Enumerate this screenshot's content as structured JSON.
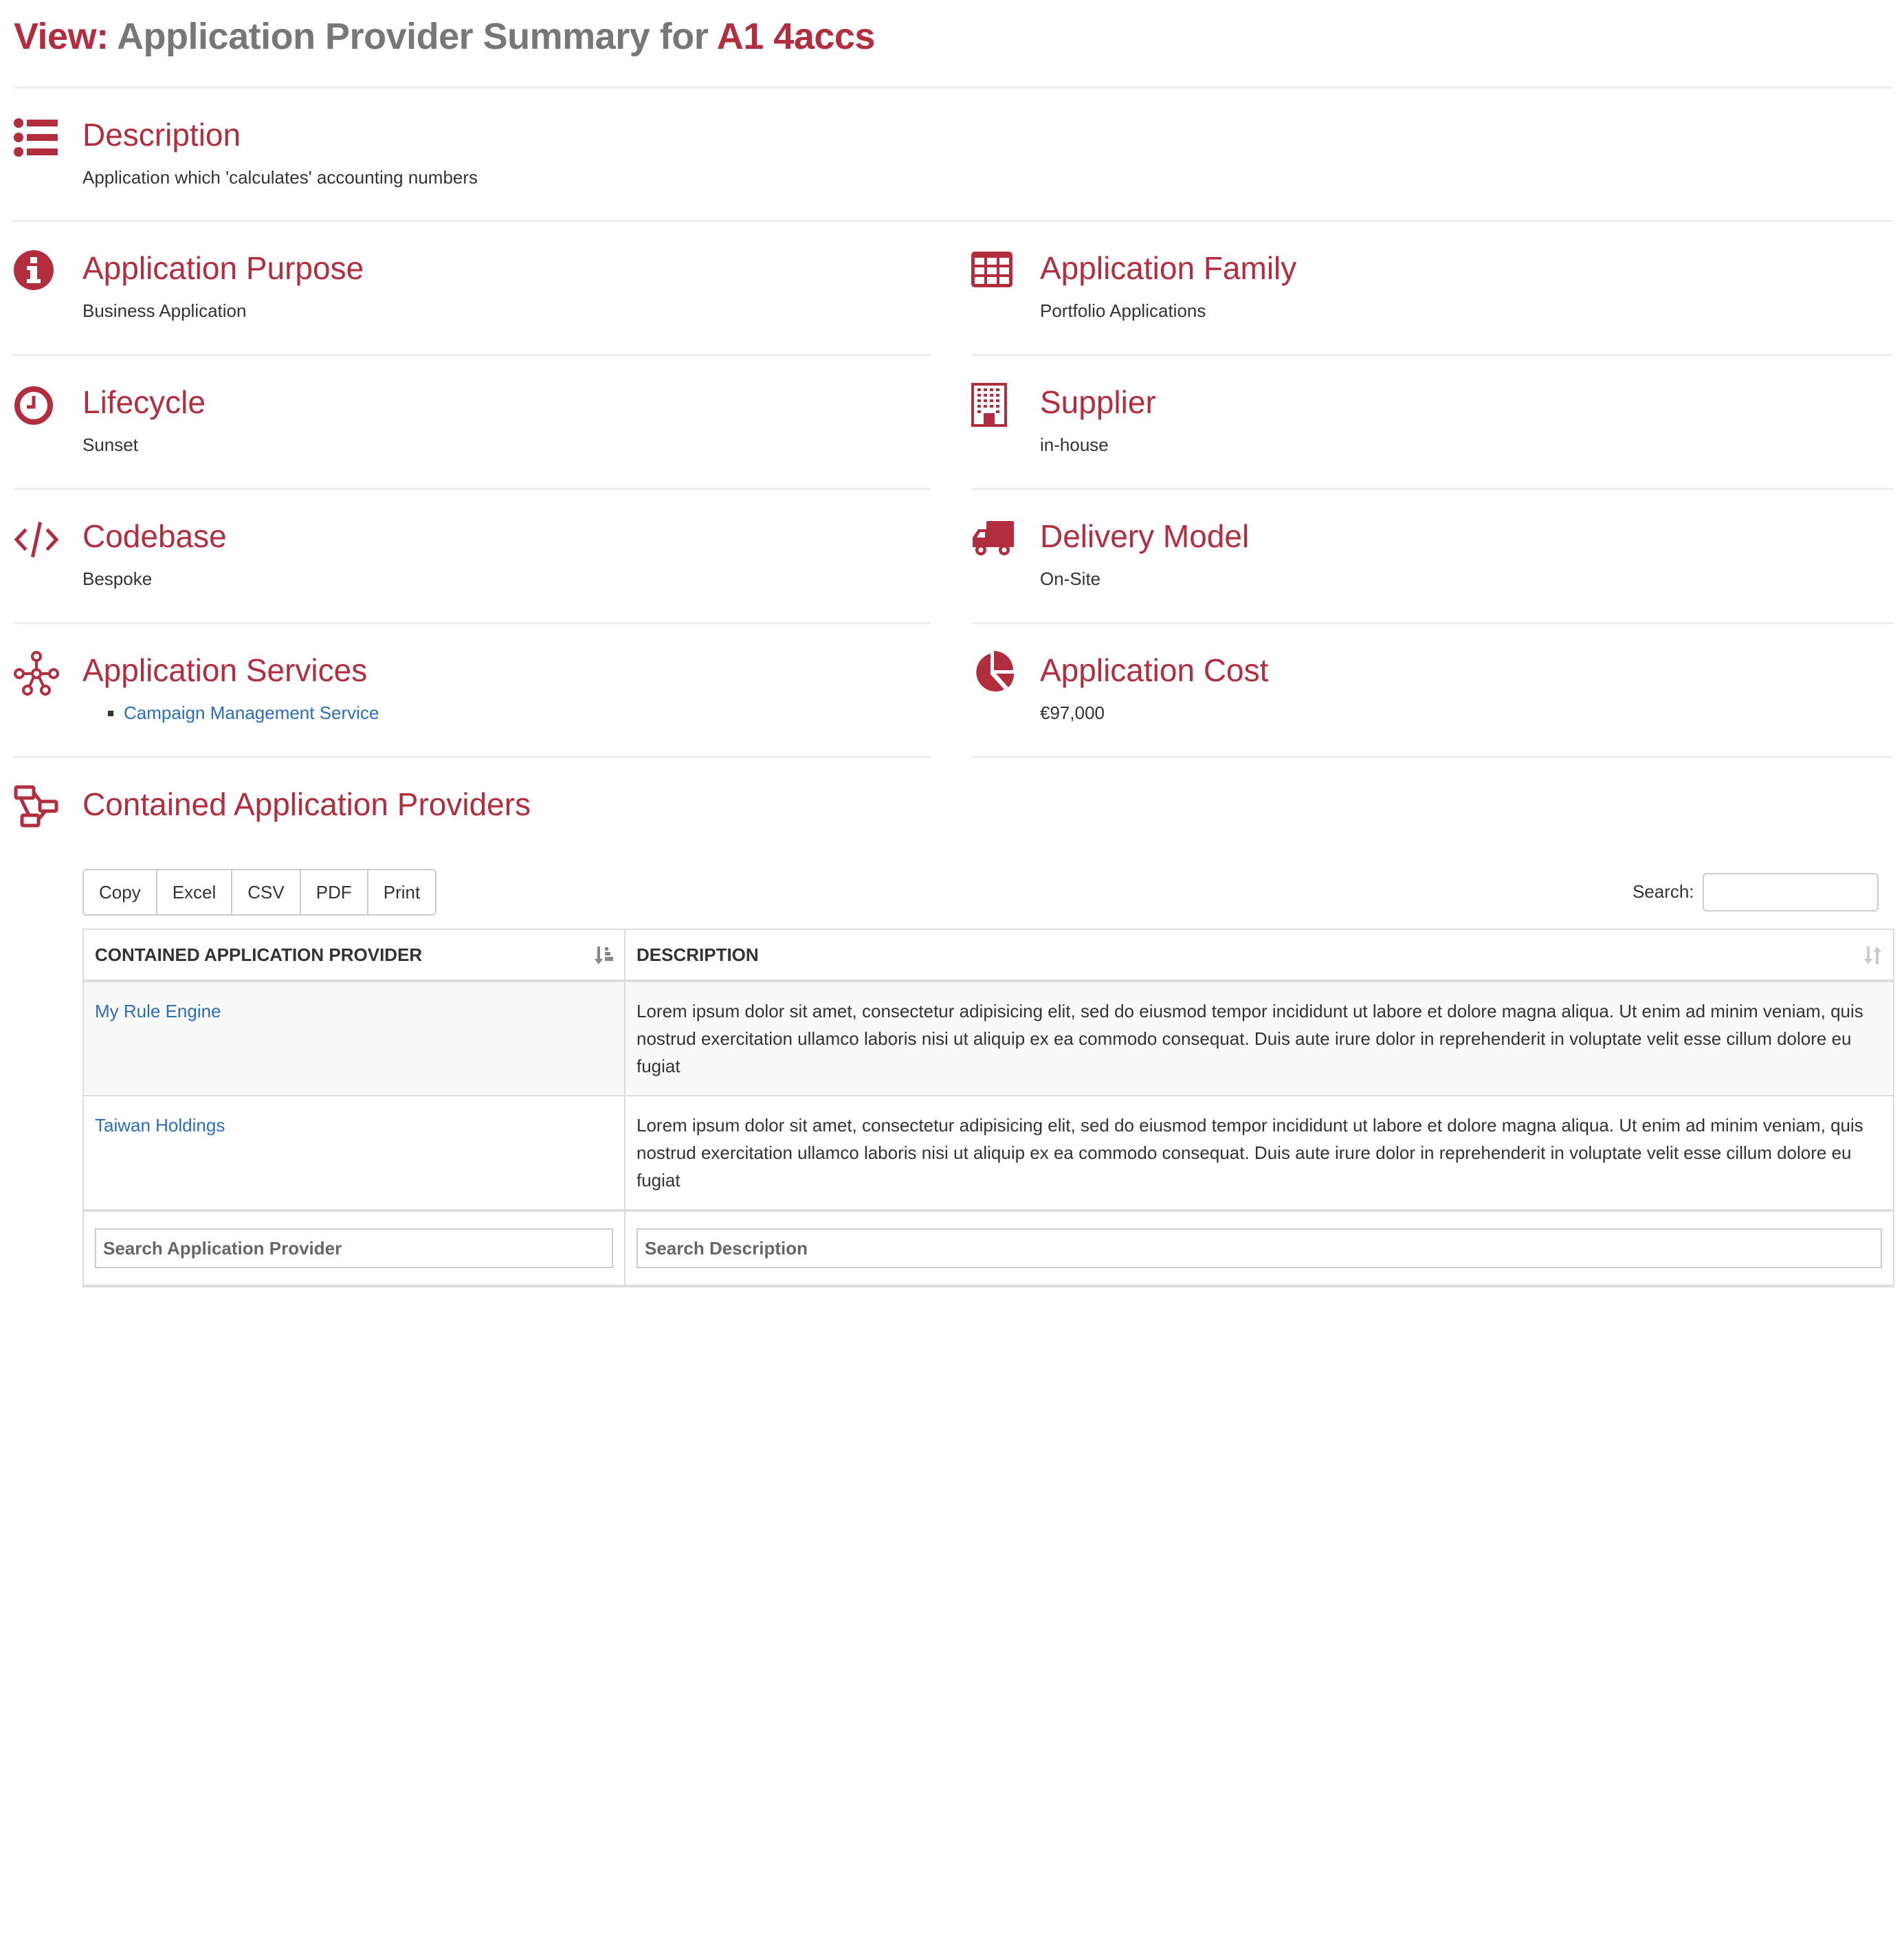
{
  "header": {
    "prefix": "View:",
    "title": " Application Provider Summary for ",
    "subject": "A1 4accs"
  },
  "colors": {
    "accent": "#b22e3e",
    "title_gray": "#777777",
    "link": "#2a6ebb",
    "text": "#333333"
  },
  "sections": {
    "description": {
      "icon": "list-icon",
      "title": "Description",
      "value": "Application which 'calculates' accounting numbers"
    },
    "purpose": {
      "icon": "info-circle-icon",
      "title": "Application Purpose",
      "value": "Business Application"
    },
    "family": {
      "icon": "table-grid-icon",
      "title": "Application Family",
      "value": "Portfolio Applications"
    },
    "lifecycle": {
      "icon": "clock-icon",
      "title": "Lifecycle",
      "value": "Sunset"
    },
    "supplier": {
      "icon": "building-icon",
      "title": "Supplier",
      "value": "in-house"
    },
    "codebase": {
      "icon": "code-icon",
      "title": "Codebase",
      "value": "Bespoke"
    },
    "delivery": {
      "icon": "truck-icon",
      "title": "Delivery Model",
      "value": "On-Site"
    },
    "services": {
      "icon": "network-nodes-icon",
      "title": "Application Services",
      "items": [
        "Campaign Management Service"
      ]
    },
    "cost": {
      "icon": "pie-chart-icon",
      "title": "Application Cost",
      "value": "€97,000"
    },
    "contained": {
      "icon": "sitemap-icon",
      "title": "Contained Application Providers"
    }
  },
  "table": {
    "buttons": [
      "Copy",
      "Excel",
      "CSV",
      "PDF",
      "Print"
    ],
    "search_label": "Search:",
    "search_value": "",
    "columns": [
      {
        "label": "Contained Application Provider",
        "sort": "ascending"
      },
      {
        "label": "Description",
        "sort": "none"
      }
    ],
    "rows": [
      {
        "name": "My Rule Engine",
        "description": "Lorem ipsum dolor sit amet, consectetur adipisicing elit, sed do eiusmod tempor incididunt ut labore et dolore magna aliqua. Ut enim ad minim veniam, quis nostrud exercitation ullamco laboris nisi ut aliquip ex ea commodo consequat. Duis aute irure dolor in reprehenderit in voluptate velit esse cillum dolore eu fugiat"
      },
      {
        "name": "Taiwan Holdings",
        "description": "Lorem ipsum dolor sit amet, consectetur adipisicing elit, sed do eiusmod tempor incididunt ut labore et dolore magna aliqua. Ut enim ad minim veniam, quis nostrud exercitation ullamco laboris nisi ut aliquip ex ea commodo consequat. Duis aute irure dolor in reprehenderit in voluptate velit esse cillum dolore eu fugiat"
      }
    ],
    "filters": [
      {
        "placeholder": "Search Application Provider"
      },
      {
        "placeholder": "Search Description"
      }
    ]
  }
}
